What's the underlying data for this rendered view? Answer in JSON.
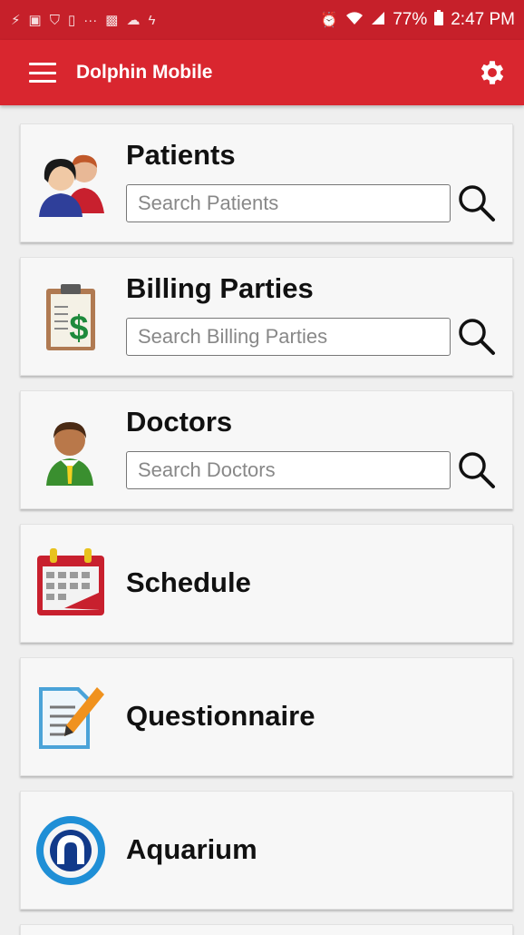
{
  "status_bar": {
    "notification_icons": [
      "activity-icon",
      "chat-icon",
      "shield-icon",
      "phone-icon",
      "more-icon",
      "facebook-icon",
      "cloud-icon",
      "flash-icon"
    ],
    "alarm_icon": "alarm-icon",
    "wifi_icon": "wifi-icon",
    "signal_icon": "signal-icon",
    "battery": "77%",
    "time": "2:47 PM"
  },
  "app_bar": {
    "title": "Dolphin Mobile",
    "menu_icon": "hamburger-menu-icon",
    "settings_icon": "gear-icon"
  },
  "colors": {
    "accent": "#d9262f",
    "status_bar": "#c6202a",
    "card": "#f7f7f7",
    "background": "#efefef"
  },
  "search_cards": [
    {
      "title": "Patients",
      "placeholder": "Search Patients",
      "icon": "patients-icon"
    },
    {
      "title": "Billing Parties",
      "placeholder": "Search Billing Parties",
      "icon": "billing-clipboard-icon"
    },
    {
      "title": "Doctors",
      "placeholder": "Search Doctors",
      "icon": "doctor-icon"
    }
  ],
  "menu_cards": [
    {
      "title": "Schedule",
      "icon": "calendar-icon"
    },
    {
      "title": "Questionnaire",
      "icon": "questionnaire-icon"
    },
    {
      "title": "Aquarium",
      "icon": "aquarium-logo-icon"
    }
  ]
}
